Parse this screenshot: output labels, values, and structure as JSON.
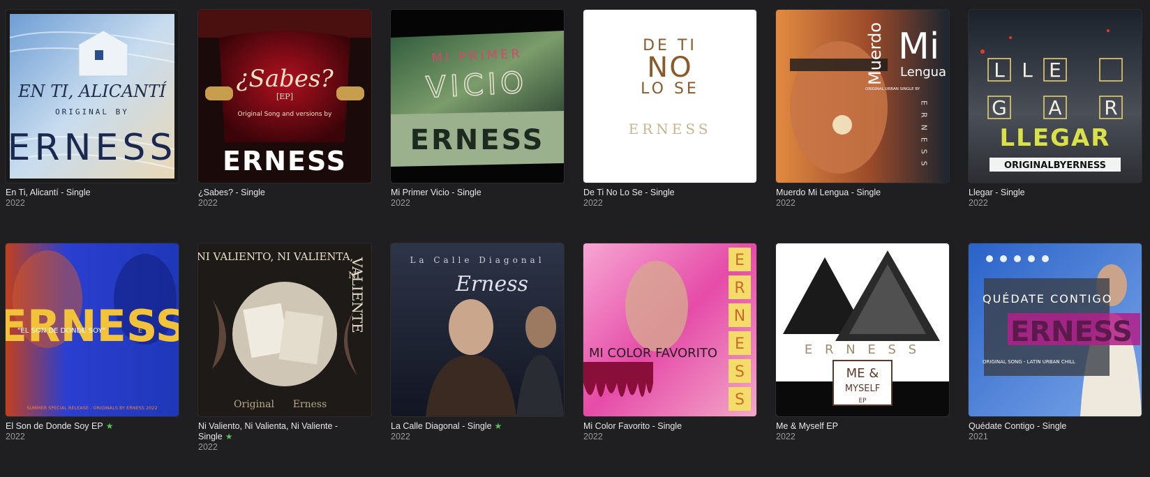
{
  "albums": [
    {
      "title": "En Ti, Alicantí - Single",
      "year": "2022",
      "star": false,
      "cover": {
        "line1": "EN TI, ALICANTÍ",
        "line2": "ORIGINAL BY",
        "line3": "ERNESS"
      }
    },
    {
      "title": "¿Sabes? - Single",
      "year": "2022",
      "star": false,
      "cover": {
        "line1": "¿Sabes?",
        "line2": "[EP]",
        "line3": "Original Song and versions by",
        "line4": "ERNESS"
      }
    },
    {
      "title": "Mi Primer Vicio - Single",
      "year": "2022",
      "star": false,
      "cover": {
        "line1": "MI PRIMER",
        "line2": "VICIO",
        "line3": "ERNESS"
      }
    },
    {
      "title": "De Ti No Lo Se - Single",
      "year": "2022",
      "star": false,
      "cover": {
        "line1": "DE TI",
        "line2": "NO",
        "line3": "LO SE",
        "line4": "ERNESS"
      }
    },
    {
      "title": "Muerdo Mi Lengua - Single",
      "year": "2022",
      "star": false,
      "cover": {
        "line1": "Mi",
        "line2": "Muerdo",
        "line3": "Lengua",
        "line4": "ORIGINAL URBAN SINGLE BY",
        "line5": "ERNESS"
      }
    },
    {
      "title": "Llegar - Single",
      "year": "2022",
      "star": false,
      "cover": {
        "letters": [
          "L",
          "L",
          "E",
          "G",
          "A",
          "R"
        ],
        "line1": "LLEGAR",
        "line2": "ORIGINALBYERNESS"
      }
    },
    {
      "title": "El Son de Donde Soy EP",
      "year": "2022",
      "star": true,
      "cover": {
        "line1": "ERNESS",
        "line2": "\"EL SON DE DONDE SOY\"",
        "line3": "EP",
        "line4": "SUMMER SPECIAL RELEASE - ORIGINALS BY ERNESS 2022"
      }
    },
    {
      "title": "Ni Valiento, Ni Valienta, Ni Valiente - Single",
      "year": "2022",
      "star": true,
      "cover": {
        "line1": "NI VALIENTO, NI VALIENTA,",
        "line2": "NI",
        "line3": "VALIENTE",
        "line4": "Original",
        "line5": "Erness"
      }
    },
    {
      "title": "La Calle Diagonal - Single",
      "year": "2022",
      "star": true,
      "cover": {
        "line1": "La Calle Diagonal",
        "line2": "Erness"
      }
    },
    {
      "title": "Mi Color Favorito - Single",
      "year": "2022",
      "star": false,
      "cover": {
        "line1": "MI COLOR FAVORITO",
        "letters": [
          "E",
          "R",
          "N",
          "E",
          "S",
          "S"
        ]
      }
    },
    {
      "title": "Me & Myself EP",
      "year": "2022",
      "star": false,
      "cover": {
        "line1": "E R N E S S",
        "line2": "ME &",
        "line3": "MYSELF",
        "line4": "EP"
      }
    },
    {
      "title": "Quédate Contigo - Single",
      "year": "2021",
      "star": false,
      "cover": {
        "line1": "QUÉDATE CONTIGO",
        "line2": "ERNESS",
        "line3": "ORIGINAL SONG - LATIN URBAN CHILL"
      }
    }
  ],
  "colors": {
    "background": "#1f1f21",
    "star": "#58c25a",
    "year": "#9a9a9a"
  }
}
